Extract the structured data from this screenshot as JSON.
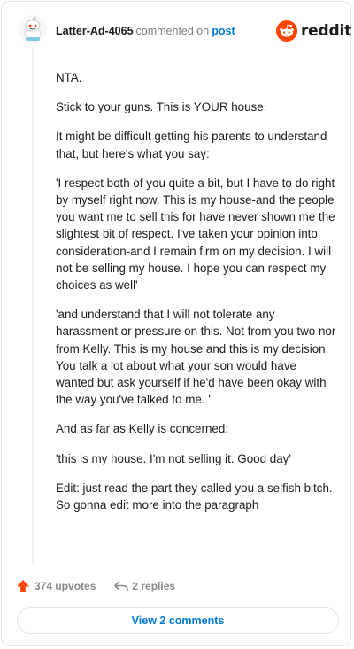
{
  "header": {
    "username": "Latter-Ad-4065",
    "action": "commented on",
    "post_link": "post",
    "brand": "reddit",
    "brand_color": "#ff4500"
  },
  "comment": {
    "paragraphs": [
      "NTA.",
      "Stick to your guns. This is YOUR house.",
      "It might be difficult getting his parents to understand that, but here's what you say:",
      "'I respect both of you quite a bit, but I have to do right by myself right now. This is my house-and the people you want me to sell this for have never shown me the slightest bit of respect. I've taken your opinion into consideration-and I remain firm on my decision. I will not be selling my house. I hope you can respect my choices as well'",
      "'and understand that I will not tolerate any harassment or pressure on this. Not from you two nor from Kelly. This is my house and this is my decision. You talk a lot about what your son would have wanted but ask yourself if he'd have been okay with the way you've talked to me. '",
      "And as far as Kelly is concerned:",
      "'this is my house. I'm not selling it. Good day'",
      "Edit: just read the part they called you a selfish bitch. So gonna edit more into the paragraph"
    ]
  },
  "footer": {
    "upvotes": "374 upvotes",
    "replies": "2 replies",
    "upvote_icon": "upvote-arrow-icon",
    "reply_icon": "reply-arrow-icon"
  },
  "view_button": {
    "label": "View 2 comments"
  }
}
